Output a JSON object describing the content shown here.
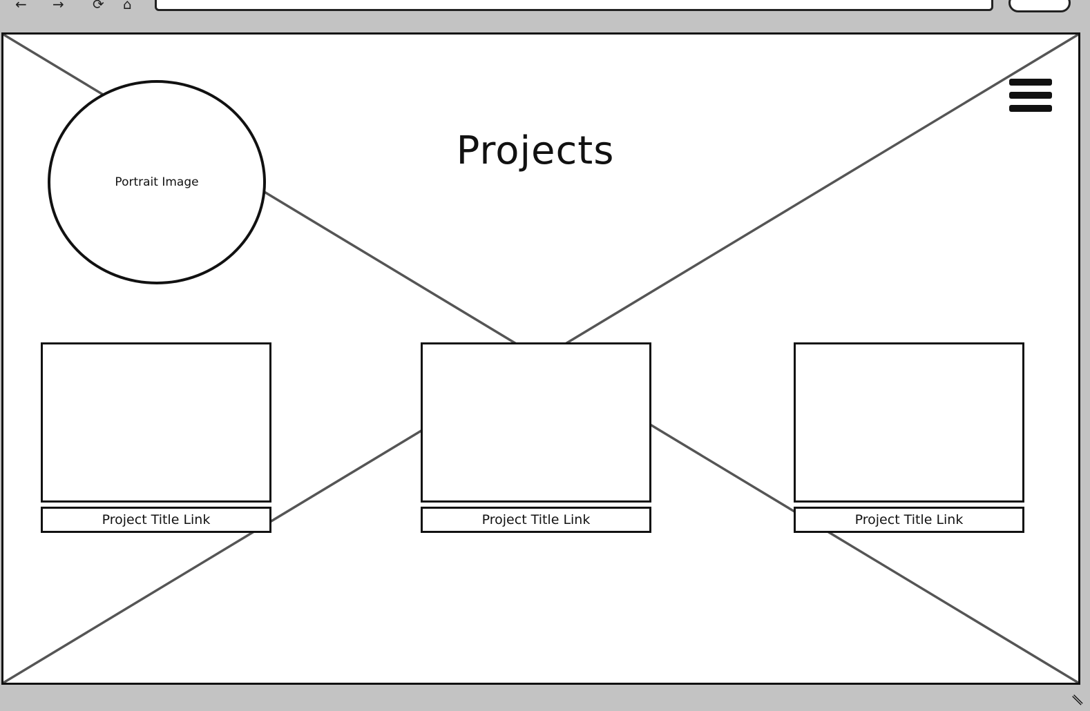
{
  "browser": {
    "nav_glyphs": [
      "back-arrow-icon",
      "forward-arrow-icon",
      "refresh-icon",
      "home-icon"
    ],
    "address_value": "",
    "search_value": ""
  },
  "header": {
    "portrait_label": "Portrait Image",
    "title": "Projects",
    "menu_icon": "hamburger-menu-icon"
  },
  "projects": [
    {
      "link_label": "Project Title Link"
    },
    {
      "link_label": "Project Title Link"
    },
    {
      "link_label": "Project Title Link"
    }
  ],
  "colors": {
    "chrome": "#c3c3c3",
    "stroke": "#111111",
    "placeholder_x": "#555555",
    "background": "#ffffff"
  }
}
